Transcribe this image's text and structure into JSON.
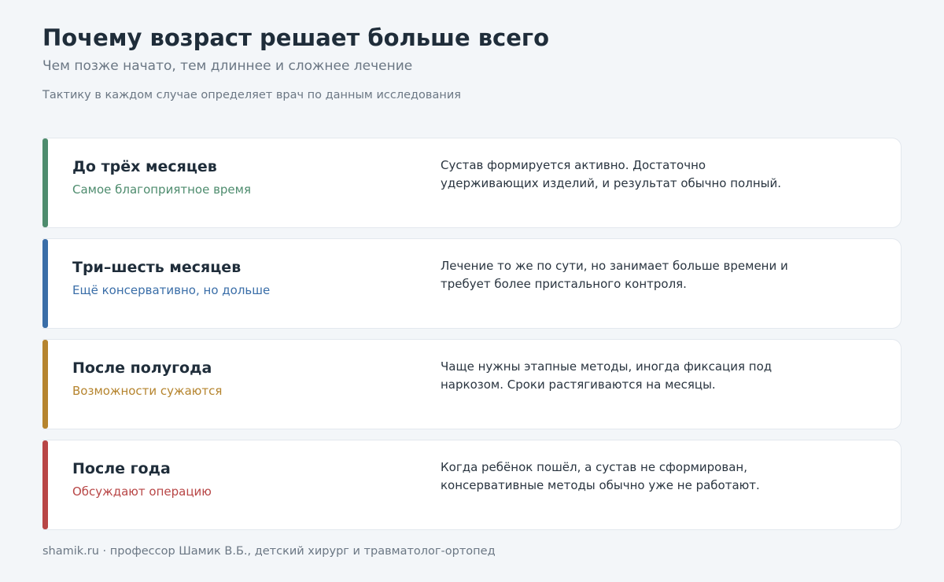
{
  "header": {
    "title": "Почему возраст решает больше всего",
    "subtitle": "Чем позже начато, тем длиннее и сложнее лечение",
    "note": "Тактику в каждом случае определяет врач по данным исследования"
  },
  "stages": [
    {
      "title": "До трёх месяцев",
      "tag": "Самое благоприятное время",
      "description": "Сустав формируется активно. Достаточно удерживающих изделий, и результат обычно полный.",
      "color": "#4e8c6e"
    },
    {
      "title": "Три–шесть месяцев",
      "tag": "Ещё консервативно, но дольше",
      "description": "Лечение то же по сути, но занимает больше времени и требует более пристального контроля.",
      "color": "#3a6ea8"
    },
    {
      "title": "После полугода",
      "tag": "Возможности сужаются",
      "description": "Чаще нужны этапные методы, иногда фиксация под наркозом. Сроки растягиваются на месяцы.",
      "color": "#b5842e"
    },
    {
      "title": "После года",
      "tag": "Обсуждают операцию",
      "description": "Когда ребёнок пошёл, а сустав не сформирован, консервативные методы обычно уже не работают.",
      "color": "#b84646"
    }
  ],
  "footer": {
    "text": "shamik.ru · профессор Шамик В.Б., детский хирург и травматолог-ортопед"
  }
}
